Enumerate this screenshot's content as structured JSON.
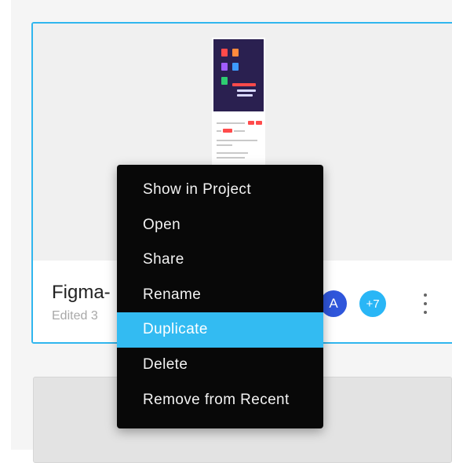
{
  "file_card": {
    "title": "Figma-",
    "edited": "Edited 3",
    "avatar_initial": "A",
    "avatar_more": "+7",
    "avatar_colors": {
      "a": "#2f56db",
      "more": "#29b6f6"
    },
    "border_color": "#30b6ee"
  },
  "kebab_icon": "more-vertical-icon",
  "context_menu": {
    "items": [
      {
        "label": "Show in Project"
      },
      {
        "label": "Open"
      },
      {
        "label": "Share"
      },
      {
        "label": "Rename"
      },
      {
        "label": "Duplicate",
        "active": true
      },
      {
        "label": "Delete"
      },
      {
        "label": "Remove from Recent"
      }
    ],
    "highlight_color": "#33bbf2",
    "background_color": "#080808"
  }
}
